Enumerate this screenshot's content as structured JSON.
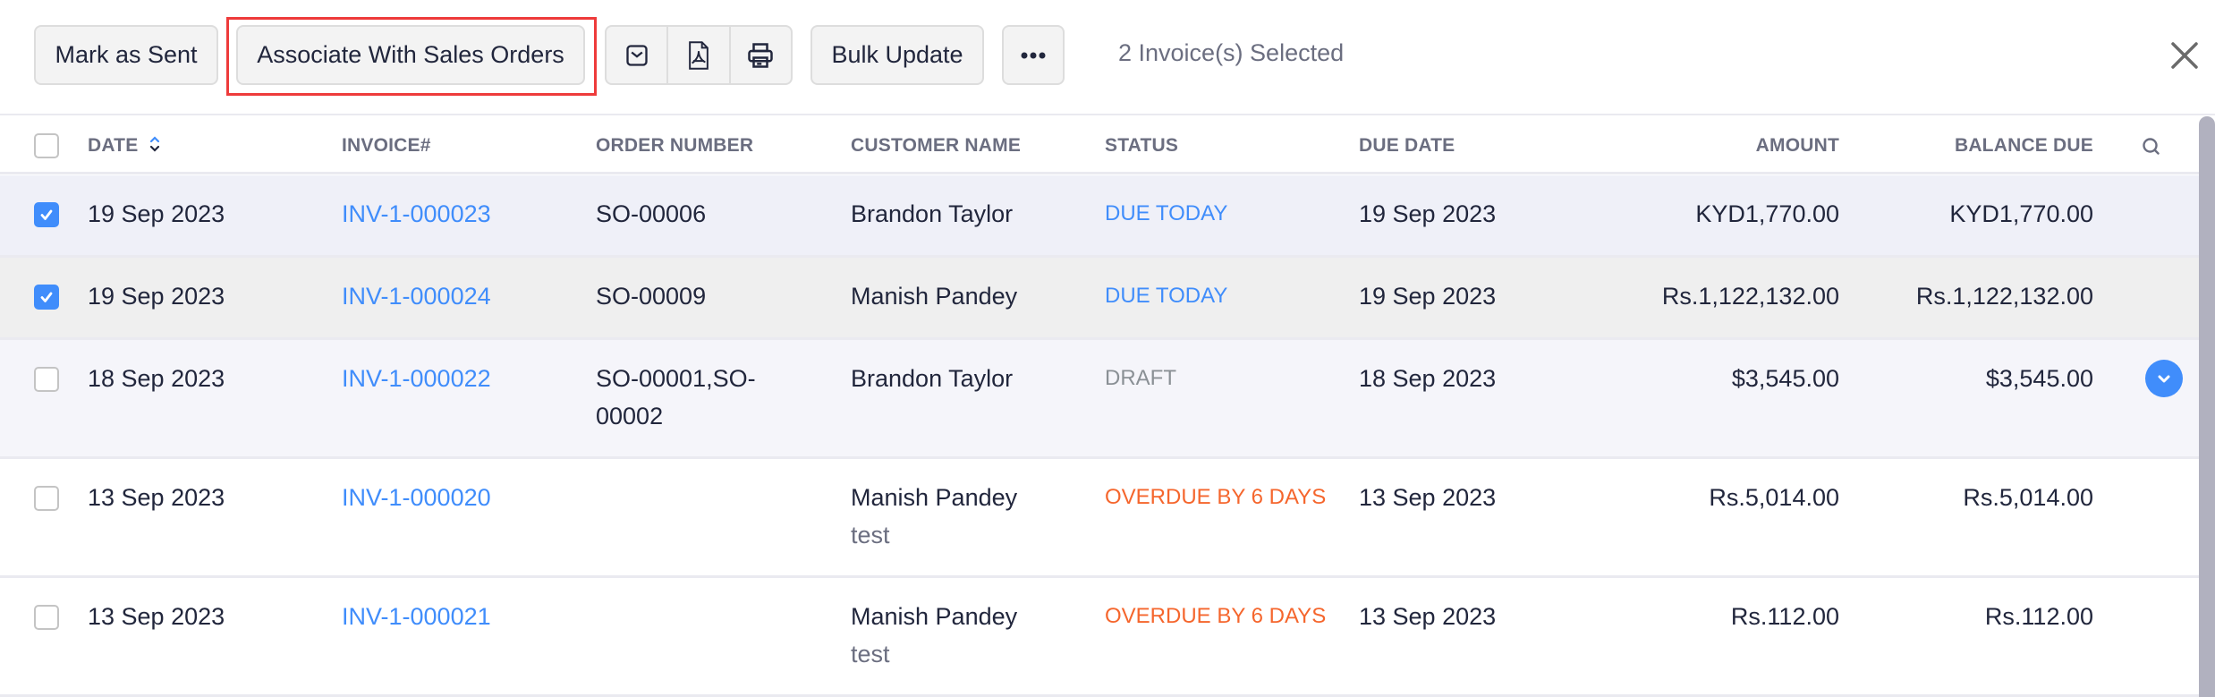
{
  "toolbar": {
    "mark_as_sent": "Mark as Sent",
    "associate_sales_orders": "Associate With Sales Orders",
    "icons": [
      "email-icon",
      "pdf-icon",
      "print-icon"
    ],
    "bulk_update": "Bulk Update",
    "more": "more-icon",
    "selection_text": "2 Invoice(s) Selected",
    "close": "close-icon"
  },
  "colors": {
    "accent": "#408dfb",
    "highlight": "#ee3b3b",
    "overdue": "#f5662d",
    "draft": "#8a9095",
    "selected_row": "#eff0f8",
    "hover_row": "#efefef"
  },
  "table": {
    "columns": [
      "DATE",
      "INVOICE#",
      "ORDER NUMBER",
      "CUSTOMER NAME",
      "STATUS",
      "DUE DATE",
      "AMOUNT",
      "BALANCE DUE"
    ],
    "rows": [
      {
        "checked": true,
        "date": "19 Sep 2023",
        "invoice": "INV-1-000023",
        "order": [
          "SO-00006"
        ],
        "customer": "Brandon Taylor",
        "customer_sub": "",
        "status": "DUE TODAY",
        "status_type": "due",
        "due_date": "19 Sep 2023",
        "amount": "KYD1,770.00",
        "balance": "KYD1,770.00"
      },
      {
        "checked": true,
        "date": "19 Sep 2023",
        "invoice": "INV-1-000024",
        "order": [
          "SO-00009"
        ],
        "customer": "Manish Pandey",
        "customer_sub": "",
        "status": "DUE TODAY",
        "status_type": "due",
        "due_date": "19 Sep 2023",
        "amount": "Rs.1,122,132.00",
        "balance": "Rs.1,122,132.00"
      },
      {
        "checked": false,
        "date": "18 Sep 2023",
        "invoice": "INV-1-000022",
        "order": [
          "SO-00001,SO-",
          "00002"
        ],
        "customer": "Brandon Taylor",
        "customer_sub": "",
        "status": "DRAFT",
        "status_type": "draft",
        "due_date": "18 Sep 2023",
        "amount": "$3,545.00",
        "balance": "$3,545.00"
      },
      {
        "checked": false,
        "date": "13 Sep 2023",
        "invoice": "INV-1-000020",
        "order": [],
        "customer": "Manish Pandey",
        "customer_sub": "test",
        "status": "OVERDUE BY 6 DAYS",
        "status_type": "overdue",
        "due_date": "13 Sep 2023",
        "amount": "Rs.5,014.00",
        "balance": "Rs.5,014.00"
      },
      {
        "checked": false,
        "date": "13 Sep 2023",
        "invoice": "INV-1-000021",
        "order": [],
        "customer": "Manish Pandey",
        "customer_sub": "test",
        "status": "OVERDUE BY 6 DAYS",
        "status_type": "overdue",
        "due_date": "13 Sep 2023",
        "amount": "Rs.112.00",
        "balance": "Rs.112.00"
      }
    ]
  }
}
